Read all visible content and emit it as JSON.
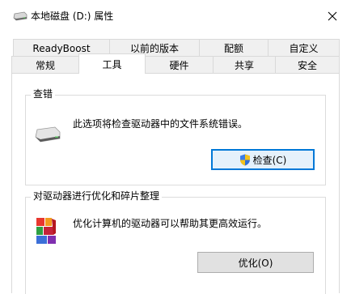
{
  "window": {
    "title": "本地磁盘 (D:) 属性",
    "title_icon": "drive-icon",
    "close_icon": "close-icon"
  },
  "tabs": {
    "row_top": [
      {
        "label": "ReadyBoost"
      },
      {
        "label": "以前的版本"
      },
      {
        "label": "配额"
      },
      {
        "label": "自定义"
      }
    ],
    "row_bottom": [
      {
        "label": "常规"
      },
      {
        "label": "工具",
        "active": true
      },
      {
        "label": "硬件"
      },
      {
        "label": "共享"
      },
      {
        "label": "安全"
      }
    ]
  },
  "error_checking": {
    "title": "查错",
    "icon": "hard-drive-icon",
    "description": "此选项将检查驱动器中的文件系统错误。",
    "button_label": "检查(C)",
    "button_icon": "uac-shield-icon"
  },
  "optimize": {
    "title": "对驱动器进行优化和碎片整理",
    "icon": "defrag-icon",
    "description": "优化计算机的驱动器可以帮助其更高效运行。",
    "button_label": "优化(O)"
  },
  "colors": {
    "accent": "#0078d7",
    "button_bg": "#e1e1e1",
    "tab_inactive_bg": "#f0f0f0"
  }
}
